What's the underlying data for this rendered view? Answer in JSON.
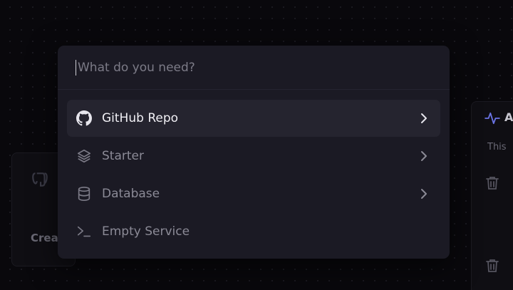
{
  "background": {
    "left_card": {
      "icon": "postgres-elephant-icon",
      "text": "Crea"
    },
    "right_card": {
      "icon": "pulse-activity-icon",
      "title_fragment": "A",
      "text": "This",
      "trash_icon": "trash-icon"
    }
  },
  "palette": {
    "search": {
      "value": "",
      "placeholder": "What do you need?"
    },
    "items": [
      {
        "label": "GitHub Repo",
        "icon": "github-icon",
        "has_submenu": true,
        "active": true
      },
      {
        "label": "Starter",
        "icon": "layers-icon",
        "has_submenu": true,
        "active": false
      },
      {
        "label": "Database",
        "icon": "database-icon",
        "has_submenu": true,
        "active": false
      },
      {
        "label": "Empty Service",
        "icon": "terminal-icon",
        "has_submenu": false,
        "active": false
      }
    ]
  },
  "colors": {
    "page_bg": "#09080c",
    "palette_bg": "#1b1a24",
    "active_item_bg": "#25242f",
    "accent_pulse": "#6b74e6"
  }
}
